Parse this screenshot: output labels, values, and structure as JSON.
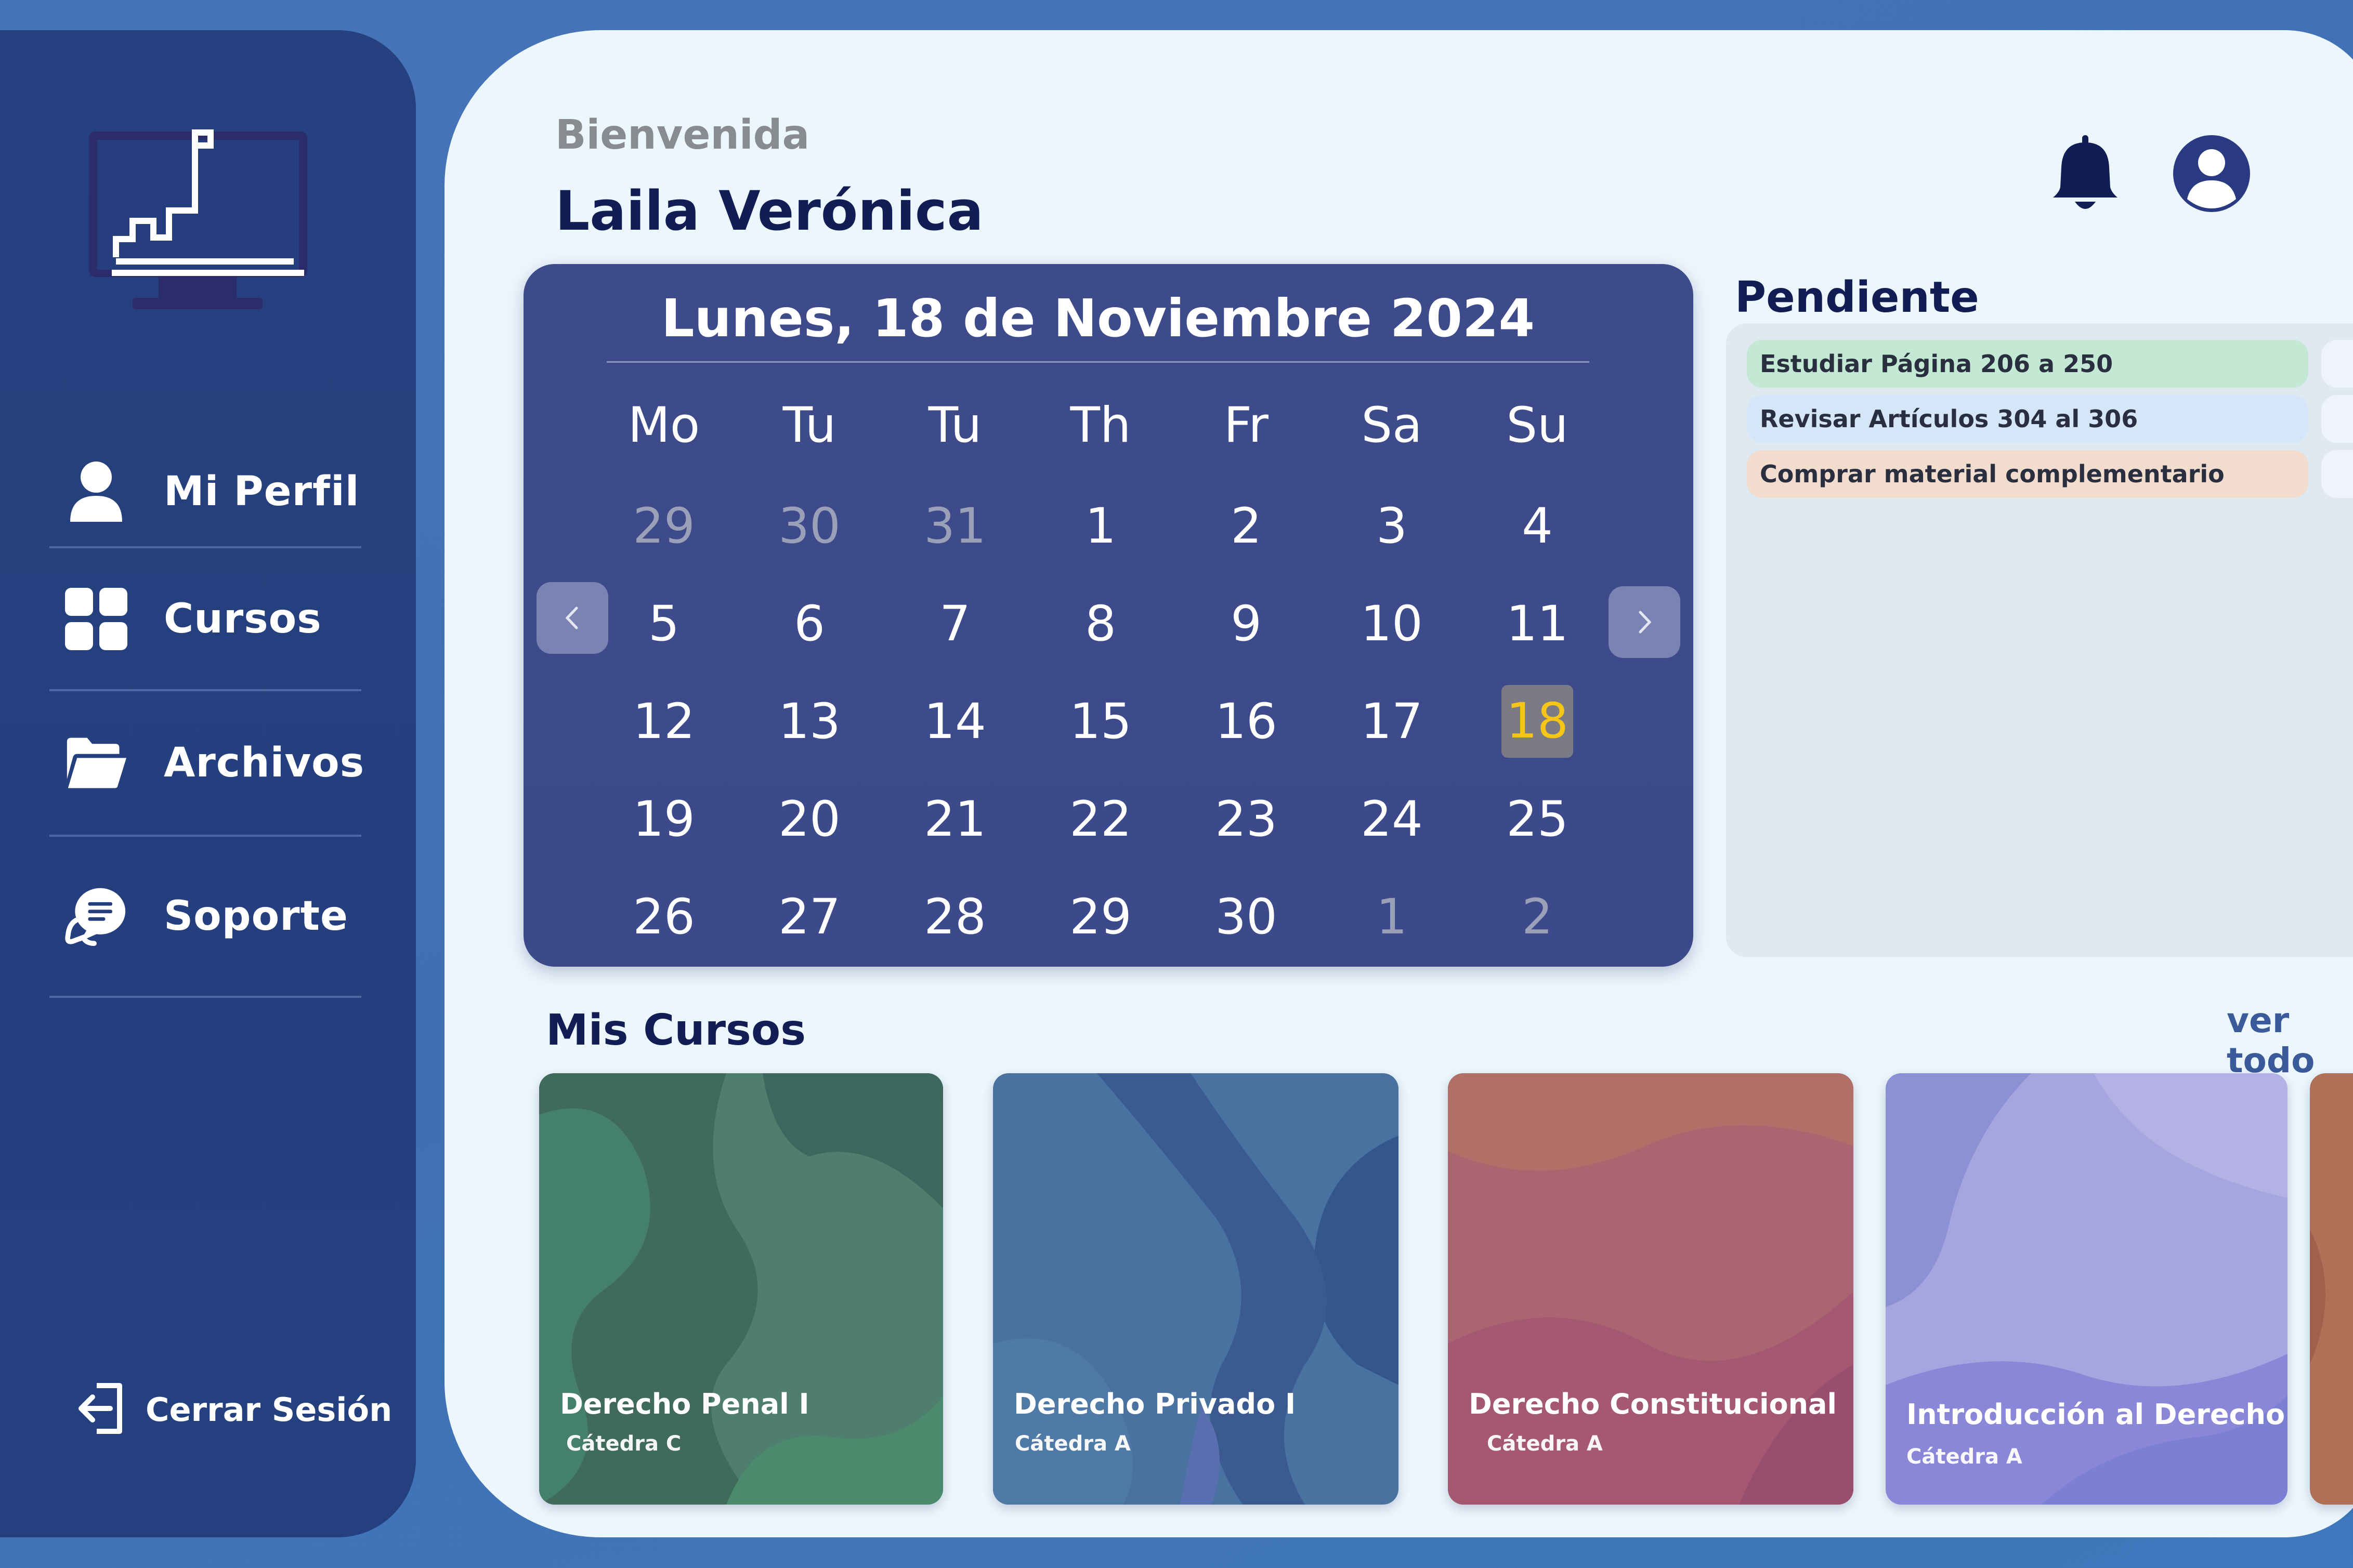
{
  "sidebar": {
    "items": [
      {
        "label": "Mi Perfil",
        "icon": "user-icon"
      },
      {
        "label": "Cursos",
        "icon": "grid-icon"
      },
      {
        "label": "Archivos",
        "icon": "folder-icon"
      },
      {
        "label": "Soporte",
        "icon": "chat-support-icon"
      }
    ],
    "logout_label": "Cerrar Sesión",
    "logout_icon": "logout-icon"
  },
  "header": {
    "greeting": "Bienvenida",
    "user_name": "Laila Verónica",
    "bell_icon": "bell-icon",
    "profile_icon": "account-icon"
  },
  "calendar": {
    "title": "Lunes, 18 de Noviembre 2024",
    "weekdays": [
      "Mo",
      "Tu",
      "Tu",
      "Th",
      "Fr",
      "Sa",
      "Su"
    ],
    "weeks": [
      [
        "29",
        "30",
        "31",
        "1",
        "2",
        "3",
        "4"
      ],
      [
        "5",
        "6",
        "7",
        "8",
        "9",
        "10",
        "11"
      ],
      [
        "12",
        "13",
        "14",
        "15",
        "16",
        "17",
        "18"
      ],
      [
        "19",
        "20",
        "21",
        "22",
        "23",
        "24",
        "25"
      ],
      [
        "26",
        "27",
        "28",
        "29",
        "30",
        "1",
        "2"
      ]
    ],
    "today": "18",
    "prev_icon": "chevron-left-icon",
    "next_icon": "chevron-right-icon"
  },
  "pending": {
    "title": "Pendiente",
    "tasks": [
      {
        "label": "Estudiar Página 206 a 250",
        "color": "#c3e8d4"
      },
      {
        "label": "Revisar Artículos 304 al 306",
        "color": "#d4e6f7"
      },
      {
        "label": "Comprar material complementario",
        "color": "#f2dccd"
      }
    ]
  },
  "courses": {
    "title": "Mis Cursos",
    "view_all": "ver todo",
    "items": [
      {
        "name": "Derecho Penal I",
        "chair": "Cátedra C"
      },
      {
        "name": "Derecho Privado I",
        "chair": "Cátedra A"
      },
      {
        "name": "Derecho Constitucional",
        "chair": "Cátedra A"
      },
      {
        "name": "Introducción al Derecho",
        "chair": "Cátedra A"
      }
    ]
  },
  "colors": {
    "background": "#4472b6",
    "sidebar": "#253f7e",
    "main_panel": "#ebf6fd",
    "calendar": "#3d4a8b",
    "heading": "#121c55",
    "today_highlight": "#f5c518"
  }
}
